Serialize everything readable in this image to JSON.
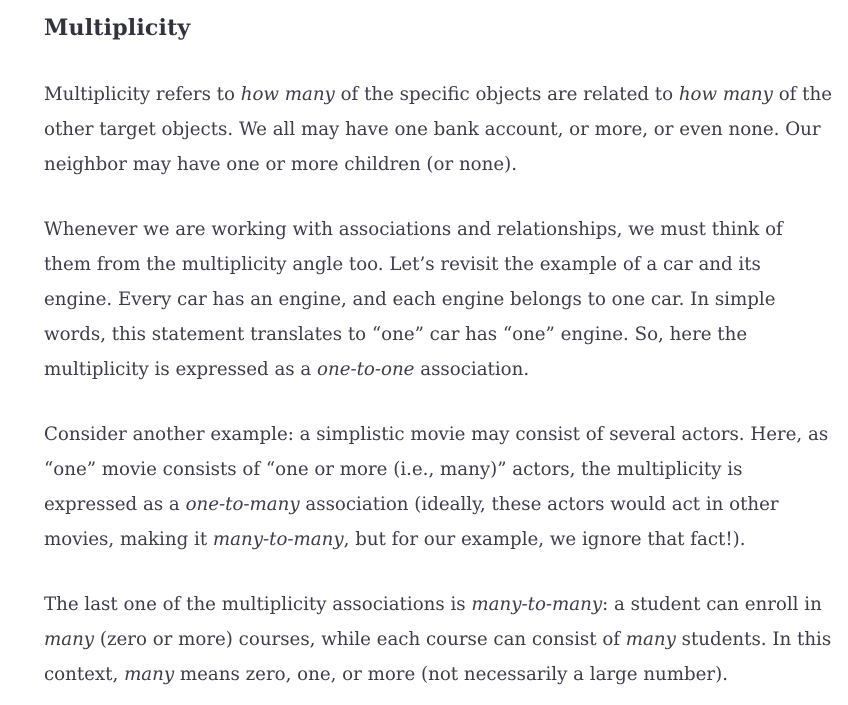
{
  "heading": "Multiplicity",
  "paragraphs": [
    {
      "id": "p1",
      "runs": [
        {
          "text": "Multiplicity refers to ",
          "italic": false
        },
        {
          "text": "how many",
          "italic": true
        },
        {
          "text": " of the specific objects are related to ",
          "italic": false
        },
        {
          "text": "how many",
          "italic": true
        },
        {
          "text": " of the other target objects. We all may have one bank account, or more, or even none. Our neighbor may have one or more children (or none).",
          "italic": false
        }
      ]
    },
    {
      "id": "p2",
      "runs": [
        {
          "text": "Whenever we are working with associations and relationships, we must think of them from the multiplicity angle too. Let’s revisit the example of a car and its engine. Every car has an engine, and each engine belongs to one car. In simple words, this statement translates to “one” car has “one” engine. So, here the multiplicity is expressed as a ",
          "italic": false
        },
        {
          "text": "one-to-one",
          "italic": true
        },
        {
          "text": " association.",
          "italic": false
        }
      ]
    },
    {
      "id": "p3",
      "runs": [
        {
          "text": "Consider another example: a simplistic movie may consist of several actors. Here, as “one” movie consists of “one or more (i.e., many)” actors, the multiplicity is expressed as a ",
          "italic": false
        },
        {
          "text": "one-to-many",
          "italic": true
        },
        {
          "text": " association (ideally, these actors would act in other movies, making it ",
          "italic": false
        },
        {
          "text": "many-to-many",
          "italic": true
        },
        {
          "text": ", but for our example, we ignore that fact!).",
          "italic": false
        }
      ]
    },
    {
      "id": "p4",
      "runs": [
        {
          "text": "The last one of the multiplicity associations is ",
          "italic": false
        },
        {
          "text": "many-to-many",
          "italic": true
        },
        {
          "text": ": a student can enroll in ",
          "italic": false
        },
        {
          "text": "many",
          "italic": true
        },
        {
          "text": " (zero or more) courses, while each course can consist of ",
          "italic": false
        },
        {
          "text": "many",
          "italic": true
        },
        {
          "text": " students. In this context, ",
          "italic": false
        },
        {
          "text": "many",
          "italic": true
        },
        {
          "text": " means zero, one, or more (not necessarily a large number).",
          "italic": false
        }
      ]
    }
  ]
}
